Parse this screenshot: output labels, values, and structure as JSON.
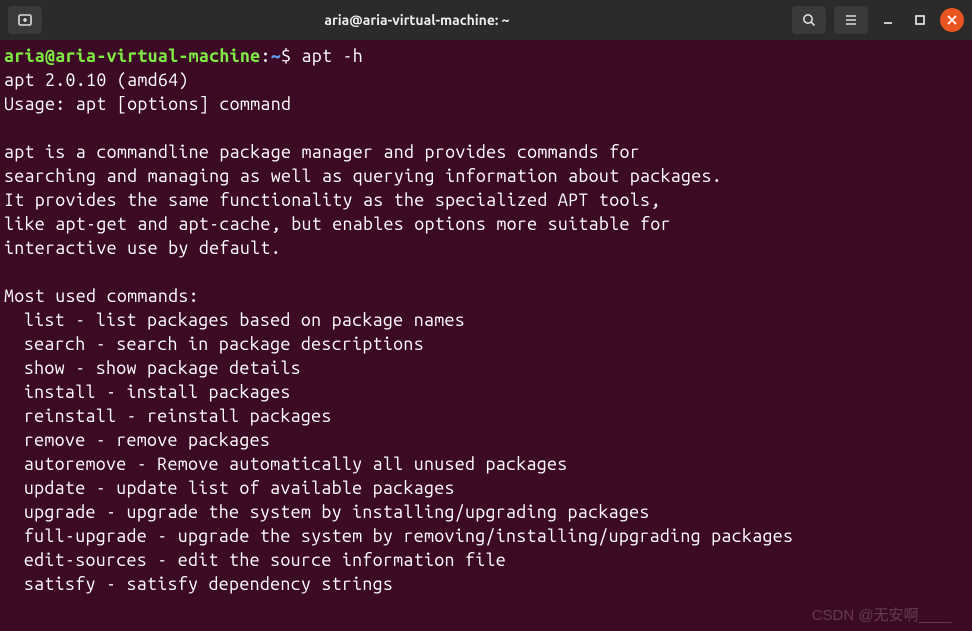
{
  "window": {
    "title": "aria@aria-virtual-machine: ~"
  },
  "prompt": {
    "user_host": "aria@aria-virtual-machine",
    "separator": ":",
    "path": "~",
    "symbol": "$",
    "command": "apt -h"
  },
  "output": {
    "version": "apt 2.0.10 (amd64)",
    "usage": "Usage: apt [options] command",
    "description": [
      "apt is a commandline package manager and provides commands for",
      "searching and managing as well as querying information about packages.",
      "It provides the same functionality as the specialized APT tools,",
      "like apt-get and apt-cache, but enables options more suitable for",
      "interactive use by default."
    ],
    "commands_header": "Most used commands:",
    "commands": [
      "list - list packages based on package names",
      "search - search in package descriptions",
      "show - show package details",
      "install - install packages",
      "reinstall - reinstall packages",
      "remove - remove packages",
      "autoremove - Remove automatically all unused packages",
      "update - update list of available packages",
      "upgrade - upgrade the system by installing/upgrading packages",
      "full-upgrade - upgrade the system by removing/installing/upgrading packages",
      "edit-sources - edit the source information file",
      "satisfy - satisfy dependency strings"
    ]
  },
  "watermark": "CSDN @无安啊____"
}
